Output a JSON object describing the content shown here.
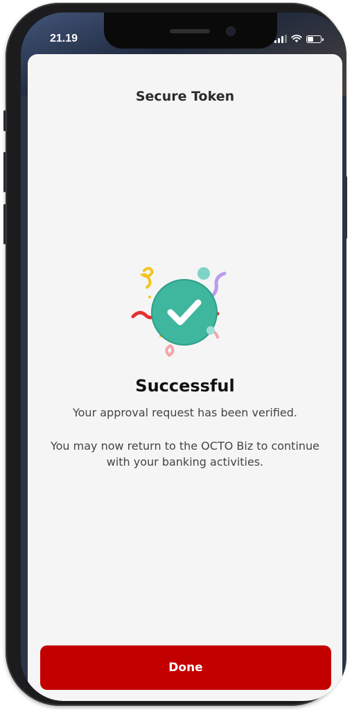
{
  "status_bar": {
    "time": "21.19",
    "signal_bars": 3,
    "wifi_icon": "wifi-icon",
    "battery_icon": "battery-icon"
  },
  "sheet": {
    "title": "Secure Token"
  },
  "result": {
    "icon": "success-check-icon",
    "title": "Successful",
    "message_primary": "Your approval request has been verified.",
    "message_secondary": "You may now return to the OCTO Biz to continue with your banking activities."
  },
  "actions": {
    "done_label": "Done"
  },
  "colors": {
    "accent": "#c30000",
    "check_green": "#3fb69e",
    "background": "#f5f5f5"
  }
}
